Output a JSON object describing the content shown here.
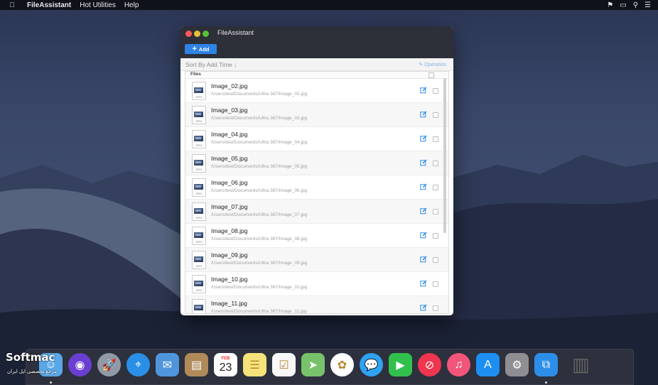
{
  "menubar": {
    "apple_icon": "apple-icon",
    "app_name": "FileAssistant",
    "menus": [
      "Hot Utilities",
      "Help"
    ],
    "status_icons": [
      "airplay-flag-icon",
      "display-mirror-icon",
      "search-icon",
      "menu-list-icon"
    ]
  },
  "window": {
    "title": "FileAssistant",
    "add_label": "Add",
    "sort_label": "Sort By Add Time ↓",
    "operation_label": "Operation",
    "files_header": "Files",
    "files": [
      {
        "name": "Image_02.jpg",
        "path": "/Users/test/Documents/Ultra 387/Image_02.jpg",
        "ext": "JPEG"
      },
      {
        "name": "Image_03.jpg",
        "path": "/Users/test/Documents/Ultra 387/Image_03.jpg",
        "ext": "JPEG"
      },
      {
        "name": "Image_04.jpg",
        "path": "/Users/test/Documents/Ultra 387/Image_04.jpg",
        "ext": "JPEG"
      },
      {
        "name": "Image_05.jpg",
        "path": "/Users/test/Documents/Ultra 387/Image_05.jpg",
        "ext": "JPEG"
      },
      {
        "name": "Image_06.jpg",
        "path": "/Users/test/Documents/Ultra 387/Image_06.jpg",
        "ext": "JPEG"
      },
      {
        "name": "Image_07.jpg",
        "path": "/Users/test/Documents/Ultra 387/Image_07.jpg",
        "ext": "JPEG"
      },
      {
        "name": "Image_08.jpg",
        "path": "/Users/test/Documents/Ultra 387/Image_08.jpg",
        "ext": "JPEG"
      },
      {
        "name": "Image_09.jpg",
        "path": "/Users/test/Documents/Ultra 387/Image_09.jpg",
        "ext": "JPEG"
      },
      {
        "name": "Image_10.jpg",
        "path": "/Users/test/Documents/Ultra 387/Image_10.jpg",
        "ext": "JPEG"
      },
      {
        "name": "Image_11.jpg",
        "path": "/Users/test/Documents/Ultra 387/Image_11.jpg",
        "ext": "JPEG"
      }
    ]
  },
  "dock": {
    "calendar_month": "FEB",
    "calendar_day": "23",
    "items": [
      {
        "name": "finder-icon",
        "color": "#5aa7e8"
      },
      {
        "name": "siri-icon",
        "color": "#6a3fd0"
      },
      {
        "name": "launchpad-icon",
        "color": "#8f9aa6"
      },
      {
        "name": "safari-icon",
        "color": "#2a8fe6"
      },
      {
        "name": "mail-icon",
        "color": "#4f95dc"
      },
      {
        "name": "contacts-icon",
        "color": "#b08a58"
      },
      {
        "name": "calendar-icon",
        "color": "#ffffff"
      },
      {
        "name": "notes-icon",
        "color": "#f6e27a"
      },
      {
        "name": "reminders-icon",
        "color": "#f7f7f7"
      },
      {
        "name": "maps-icon",
        "color": "#77c26a"
      },
      {
        "name": "photos-icon",
        "color": "#ffffff"
      },
      {
        "name": "messages-icon",
        "color": "#2fa2f3"
      },
      {
        "name": "facetime-icon",
        "color": "#31c04c"
      },
      {
        "name": "news-icon",
        "color": "#f0364f"
      },
      {
        "name": "music-icon",
        "color": "#f2557a"
      },
      {
        "name": "app-store-icon",
        "color": "#1d8ff2"
      },
      {
        "name": "system-preferences-icon",
        "color": "#8e8e93"
      },
      {
        "name": "fileassistant-icon",
        "color": "#2c8ee8"
      },
      {
        "name": "trash-full-icon",
        "color": "#cfcfd3"
      }
    ]
  },
  "watermark": {
    "brand": "Softmac",
    "tagline": "مرجع تخصصی اپل ایران"
  }
}
